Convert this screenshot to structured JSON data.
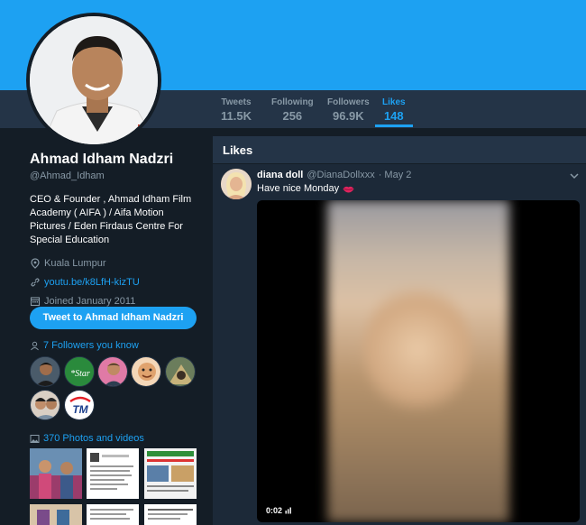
{
  "profile": {
    "name": "Ahmad Idham Nadzri",
    "handle": "@Ahmad_Idham",
    "bio": "CEO & Founder , Ahmad Idham Film Academy ( AIFA ) / Aifa Motion Pictures / Eden Firdaus Centre For Special Education",
    "location": "Kuala Lumpur",
    "url": "youtu.be/k8LfH-kizTU",
    "joined": "Joined January 2011"
  },
  "stats": [
    {
      "label": "Tweets",
      "value": "11.5K"
    },
    {
      "label": "Following",
      "value": "256"
    },
    {
      "label": "Followers",
      "value": "96.9K"
    },
    {
      "label": "Likes",
      "value": "148"
    }
  ],
  "tweet_button": "Tweet to Ahmad Idham Nadzri",
  "followers_you_know": "7 Followers you know",
  "photos_videos": "370 Photos and videos",
  "likes_title": "Likes",
  "tweet": {
    "name": "diana doll",
    "handle": "@DianaDollxxx",
    "date": "· May 2",
    "text": "Have nice Monday",
    "duration": "0:02"
  },
  "colors": {
    "accent": "#1da1f2",
    "background": "#141d26",
    "panel": "#1c2938",
    "nav": "#243447",
    "muted": "#8899a6"
  },
  "icons": [
    "location-icon",
    "link-icon",
    "calendar-icon",
    "people-icon",
    "photo-icon",
    "chevron-down-icon",
    "lips-icon",
    "volume-icon"
  ],
  "known_followers": [
    {
      "label": "",
      "kind": "person"
    },
    {
      "label": "*Star",
      "kind": "logo"
    },
    {
      "label": "",
      "kind": "person"
    },
    {
      "label": "",
      "kind": "person"
    },
    {
      "label": "",
      "kind": "person"
    },
    {
      "label": "",
      "kind": "person"
    },
    {
      "label": "TM",
      "kind": "logo"
    }
  ]
}
